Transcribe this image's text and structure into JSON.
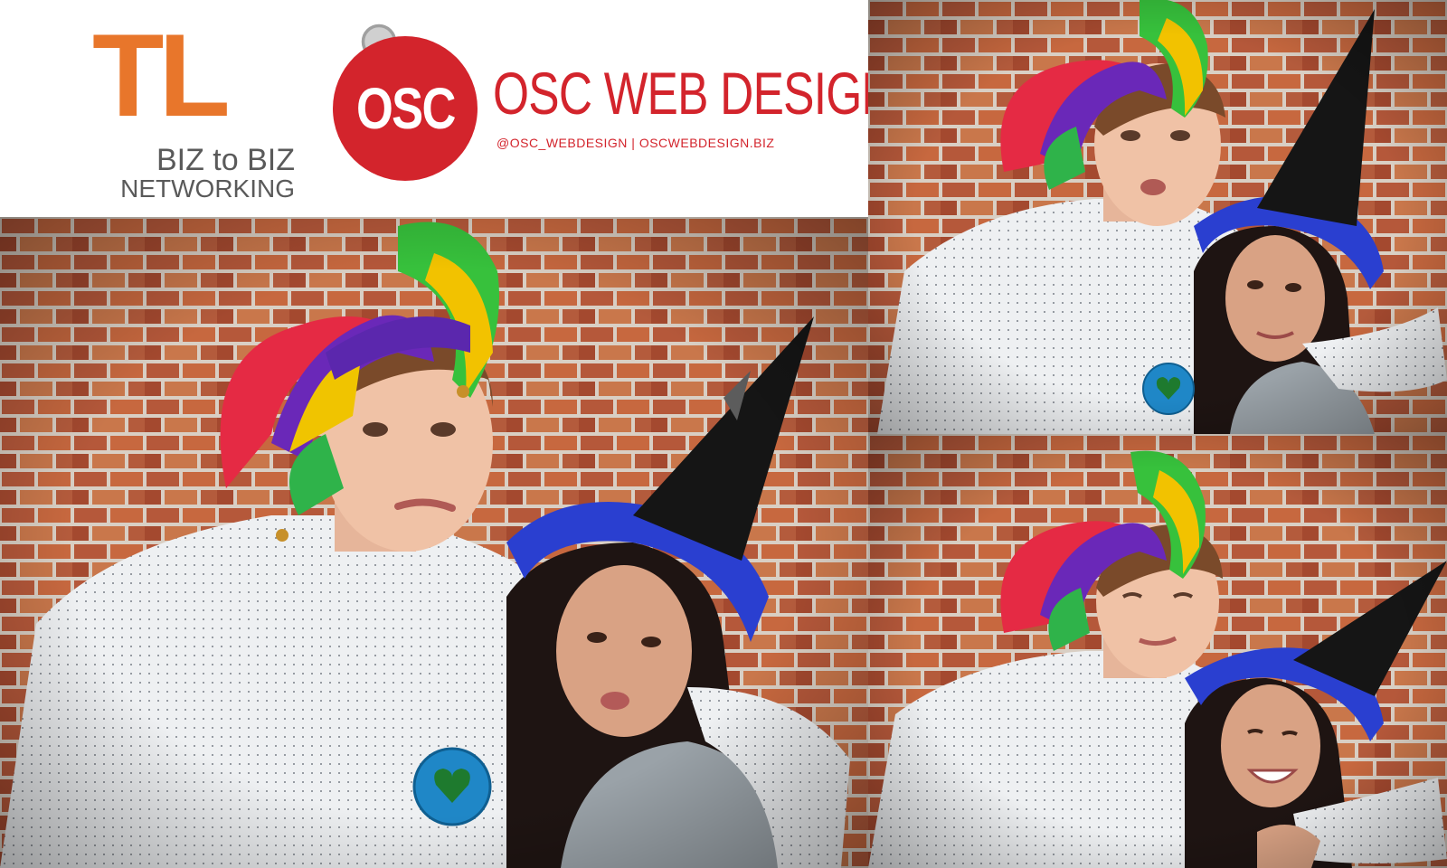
{
  "header": {
    "tl_letters": "TL",
    "tl_line1": "BIZ to BIZ",
    "tl_line2": "NETWORKING",
    "osc_mark": "OSC",
    "osc_title": "OSC WEB DESIGN",
    "osc_contact": "@OSC_WEBDESIGN  |  OSCWEBDESIGN.BIZ"
  },
  "colors": {
    "tl_orange": "#e8762b",
    "osc_red": "#d3242c",
    "brick": "#b5583a",
    "mortar": "#d9cfc4",
    "shirt": "#eef0f2",
    "witch_hat_brim": "#2a3fd0"
  },
  "photos": [
    {
      "name": "photo-main",
      "subjects": [
        "jester-hat",
        "witch-hat",
        "badge"
      ]
    },
    {
      "name": "photo-top-right",
      "subjects": [
        "jester-hat",
        "witch-hat",
        "badge"
      ]
    },
    {
      "name": "photo-bottom-right",
      "subjects": [
        "jester-hat",
        "witch-hat"
      ]
    }
  ]
}
